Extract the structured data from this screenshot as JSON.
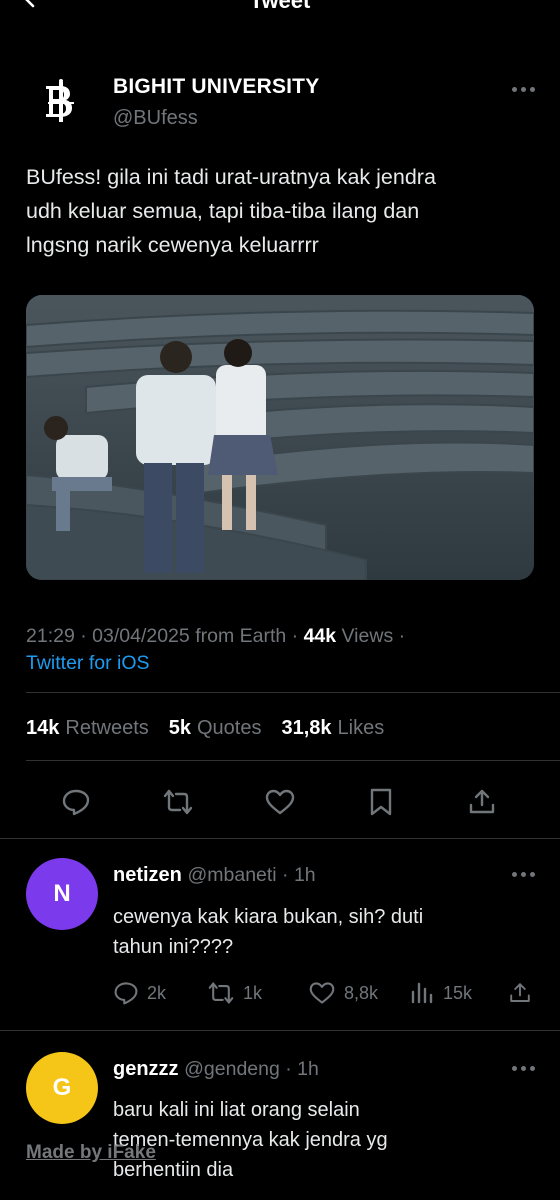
{
  "header": {
    "title": "Tweet"
  },
  "author": {
    "name": "BIGHIT UNIVERSITY",
    "handle": "@BUfess",
    "avatar_icon": "bu-crest-logo"
  },
  "tweet": {
    "lines": [
      "BUfess! gila ini tadi urat-uratnya kak jendra",
      "udh keluar semua, tapi tiba-tiba ilang dan",
      "lngsng narik cewenya keluarrrr"
    ],
    "media_description": "photo",
    "time": "21:29",
    "date": "03/04/2025",
    "location": "from Earth",
    "views_count": "44k",
    "views_label": "Views",
    "source": "Twitter for iOS"
  },
  "stats": {
    "retweets_count": "14k",
    "retweets_label": "Retweets",
    "quotes_count": "5k",
    "quotes_label": "Quotes",
    "likes_count": "31,8k",
    "likes_label": "Likes"
  },
  "action_icons": [
    "reply-icon",
    "retweet-icon",
    "like-icon",
    "bookmark-icon",
    "share-icon"
  ],
  "replies": [
    {
      "avatar_letter": "N",
      "avatar_color": "#7c3aed",
      "name": "netizen",
      "handle": "@mbaneti · 1h",
      "lines": [
        "cewenya kak kiara bukan, sih? duti",
        "tahun ini????"
      ],
      "replies": "2k",
      "retweets": "1k",
      "likes": "8,8k",
      "views": "15k"
    },
    {
      "avatar_letter": "G",
      "avatar_color": "#f5c518",
      "name": "genzzz",
      "handle": "@gendeng · 1h",
      "lines": [
        "baru kali ini liat orang selain",
        "temen-temennya kak jendra yg",
        "berhentiin dia"
      ]
    }
  ],
  "watermark": "Made by iFake"
}
